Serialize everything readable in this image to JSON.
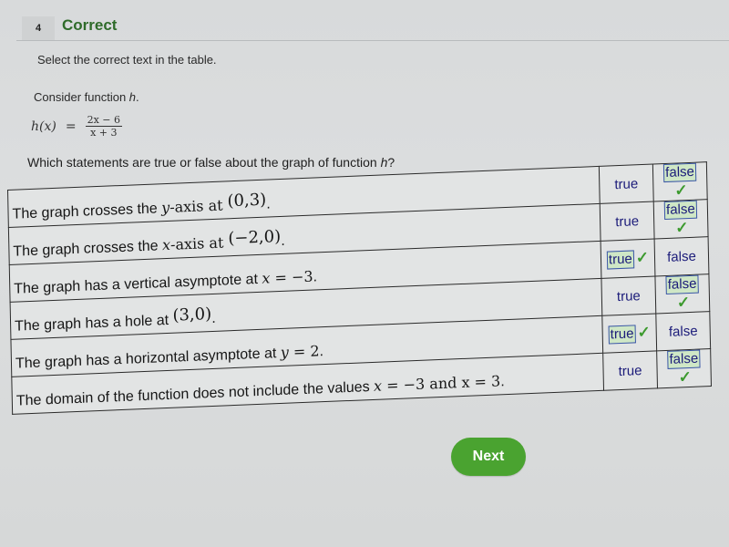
{
  "header": {
    "question_number": "4",
    "status": "Correct"
  },
  "instruction": "Select the correct text in the table.",
  "consider": {
    "prefix": "Consider function ",
    "fn": "h",
    "suffix": "."
  },
  "formula": {
    "lhs": "h(x)",
    "eq": "=",
    "numerator": "2x − 6",
    "denominator": "x + 3"
  },
  "question": {
    "prefix": "Which statements are true or false about the graph of function ",
    "fn": "h",
    "suffix": "?"
  },
  "rows": [
    {
      "parts": [
        "The graph crosses the ",
        "y",
        "-axis at ",
        "(0,3)",
        "."
      ],
      "true_label": "true",
      "false_label": "false",
      "selected": "false",
      "correct": true
    },
    {
      "parts": [
        "The graph crosses the ",
        "x",
        "-axis at ",
        "(−2,0)",
        "."
      ],
      "true_label": "true",
      "false_label": "false",
      "selected": "false",
      "correct": true
    },
    {
      "parts": [
        "The graph has a vertical asymptote at ",
        "x",
        " = −3",
        "",
        "."
      ],
      "true_label": "true",
      "false_label": "false",
      "selected": "true",
      "correct": true
    },
    {
      "parts": [
        "The graph has a hole at ",
        "",
        "",
        "(3,0)",
        "."
      ],
      "true_label": "true",
      "false_label": "false",
      "selected": "false",
      "correct": true
    },
    {
      "parts": [
        "The graph has a horizontal asymptote at ",
        "y",
        " = 2",
        "",
        "."
      ],
      "true_label": "true",
      "false_label": "false",
      "selected": "true",
      "correct": true
    },
    {
      "parts": [
        "The domain of the function does not include the values ",
        "x",
        " = −3 and x = 3",
        "",
        "."
      ],
      "true_label": "true",
      "false_label": "false",
      "selected": "false",
      "correct": true
    }
  ],
  "check_icon": "✓",
  "next_button": "Next",
  "colors": {
    "status": "#2f6b2a",
    "selected_bg": "#cfe7c6",
    "selected_border": "#3b56a8",
    "check": "#3c9a2e",
    "next_bg": "#4aa330"
  }
}
